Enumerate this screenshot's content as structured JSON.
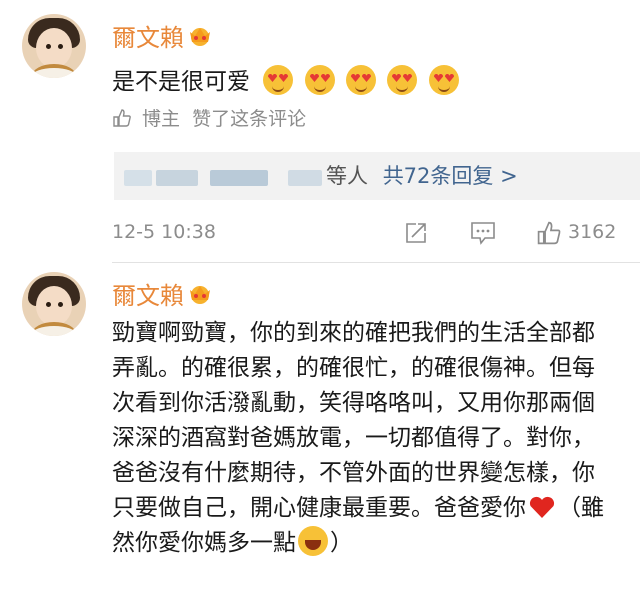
{
  "comment1": {
    "username": "爾文賴",
    "text": "是不是很可爱",
    "emoji_count": 5,
    "emoji_icon": "heart-eyes-emoji",
    "author_like_prefix": "博主",
    "author_like_text": "赞了这条评论",
    "reply_others": "等人",
    "reply_total": "共72条回复 >",
    "timestamp": "12-5 10:38",
    "like_count": "3162"
  },
  "comment2": {
    "username": "爾文賴",
    "text_main": "勁寶啊勁寶，你的到來的確把我們的生活全部都弄亂。的確很累，的確很忙，的確很傷神。但每次看到你活潑亂動，笑得咯咯叫，又用你那兩個深深的酒窩對爸媽放電，一切都值得了。對你，爸爸沒有什麼期待，不管外面的世界變怎樣，你只要做自己，開心健康最重要。爸爸愛你",
    "text_after_heart": "（雖然你愛你媽多一點",
    "text_end": "）"
  },
  "colors": {
    "username": "#e8883a",
    "link": "#41658f",
    "meta": "#8c8c8c"
  }
}
